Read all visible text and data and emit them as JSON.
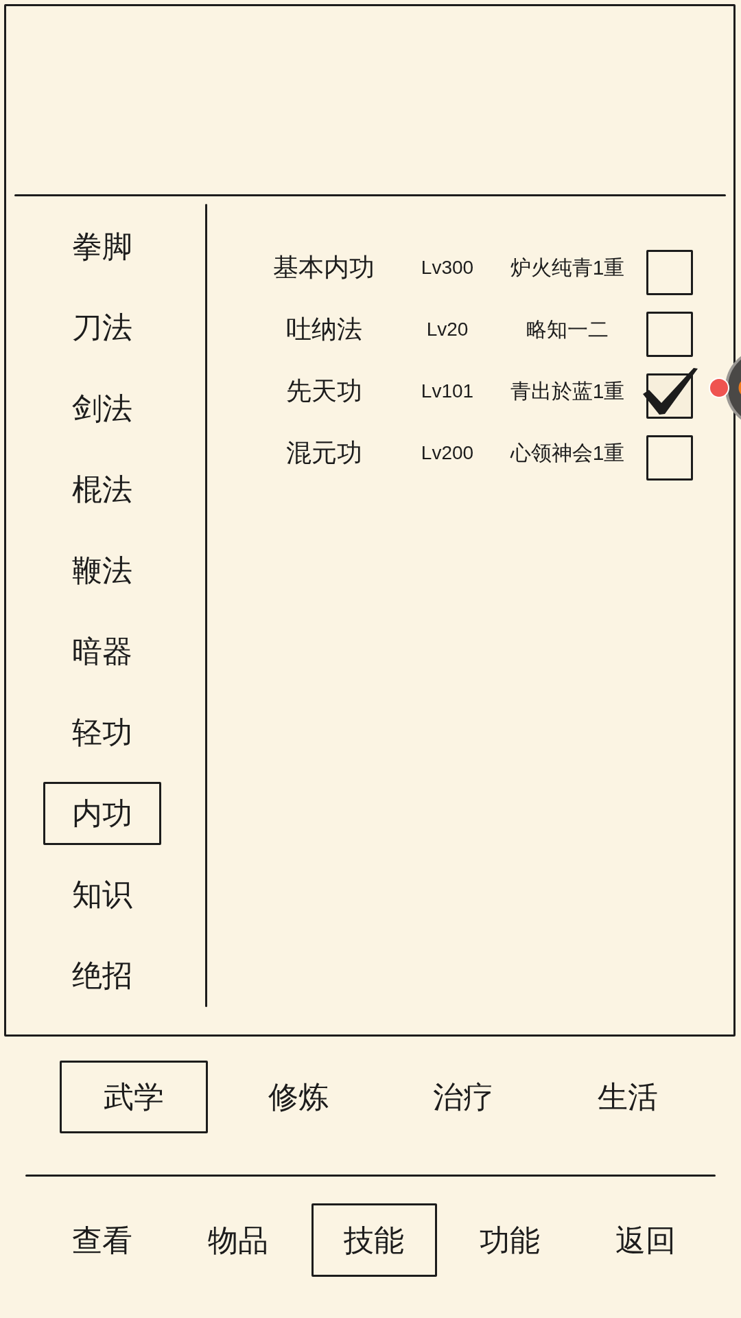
{
  "categories": [
    {
      "label": "拳脚",
      "selected": false
    },
    {
      "label": "刀法",
      "selected": false
    },
    {
      "label": "剑法",
      "selected": false
    },
    {
      "label": "棍法",
      "selected": false
    },
    {
      "label": "鞭法",
      "selected": false
    },
    {
      "label": "暗器",
      "selected": false
    },
    {
      "label": "轻功",
      "selected": false
    },
    {
      "label": "内功",
      "selected": true
    },
    {
      "label": "知识",
      "selected": false
    },
    {
      "label": "绝招",
      "selected": false
    }
  ],
  "skills": [
    {
      "name": "基本内功",
      "lv": "Lv300",
      "realm": "炉火纯青1重",
      "checked": false
    },
    {
      "name": "吐纳法",
      "lv": "Lv20",
      "realm": "略知一二",
      "checked": false
    },
    {
      "name": "先天功",
      "lv": "Lv101",
      "realm": "青出於蓝1重",
      "checked": true
    },
    {
      "name": "混元功",
      "lv": "Lv200",
      "realm": "心领神会1重",
      "checked": false
    }
  ],
  "skill_tabs": [
    {
      "label": "武学",
      "selected": true
    },
    {
      "label": "修炼",
      "selected": false
    },
    {
      "label": "治疗",
      "selected": false
    },
    {
      "label": "生活",
      "selected": false
    }
  ],
  "nav": [
    {
      "label": "查看",
      "selected": false
    },
    {
      "label": "物品",
      "selected": false
    },
    {
      "label": "技能",
      "selected": true
    },
    {
      "label": "功能",
      "selected": false
    },
    {
      "label": "返回",
      "selected": false
    }
  ]
}
